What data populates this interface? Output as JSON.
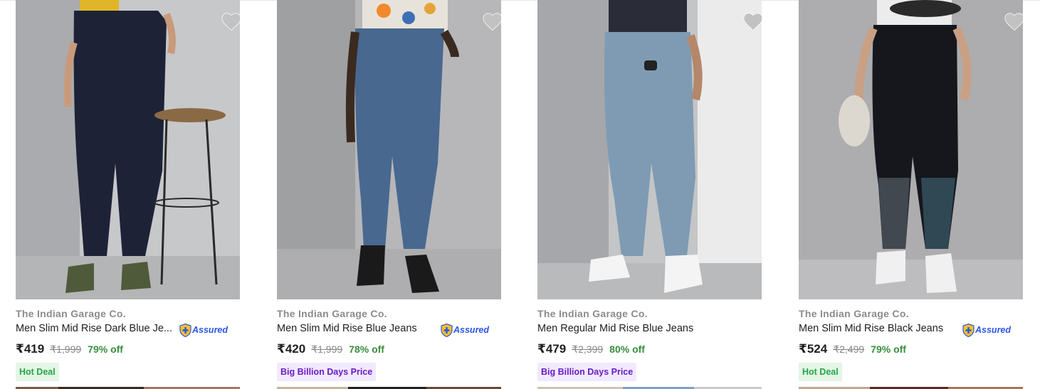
{
  "products": [
    {
      "brand": "The Indian Garage Co.",
      "title": "Men Slim Mid Rise Dark Blue Je...",
      "assured": "Assured",
      "price": "₹419",
      "mrp": "₹1,999",
      "discount": "79% off",
      "tag": "Hot Deal",
      "tag_type": "hot",
      "jeans_color": "#1e2236",
      "shirt_color": "#e0b52a",
      "bg_color": "#bfc0c2"
    },
    {
      "brand": "The Indian Garage Co.",
      "title": "Men Slim Mid Rise Blue Jeans",
      "assured": "Assured",
      "price": "₹420",
      "mrp": "₹1,999",
      "discount": "78% off",
      "tag": "Big Billion Days Price",
      "tag_type": "bbd",
      "jeans_color": "#48688f",
      "shirt_color": "#e8e3da",
      "bg_color": "#b9b9b9"
    },
    {
      "brand": "The Indian Garage Co.",
      "title": "Men Regular Mid Rise Blue Jeans",
      "assured": "",
      "price": "₹479",
      "mrp": "₹2,399",
      "discount": "80% off",
      "tag": "Big Billion Days Price",
      "tag_type": "bbd",
      "jeans_color": "#7e9bb3",
      "shirt_color": "#2a2d38",
      "bg_color": "#c3c4c6"
    },
    {
      "brand": "The Indian Garage Co.",
      "title": "Men Slim Mid Rise Black Jeans",
      "assured": "Assured",
      "price": "₹524",
      "mrp": "₹2,499",
      "discount": "79% off",
      "tag": "Hot Deal",
      "tag_type": "hot",
      "jeans_color": "#15171c",
      "shirt_color": "#ececec",
      "bg_color": "#a9a9ab"
    }
  ],
  "icons": {
    "wishlist": "heart-icon",
    "assured": "shield-plus-icon"
  },
  "colors": {
    "assured_blue": "#2a55e5",
    "discount_green": "#388e3c",
    "hot_tag_bg": "#e3f6e7",
    "bbd_tag_bg": "#f1eaff"
  }
}
